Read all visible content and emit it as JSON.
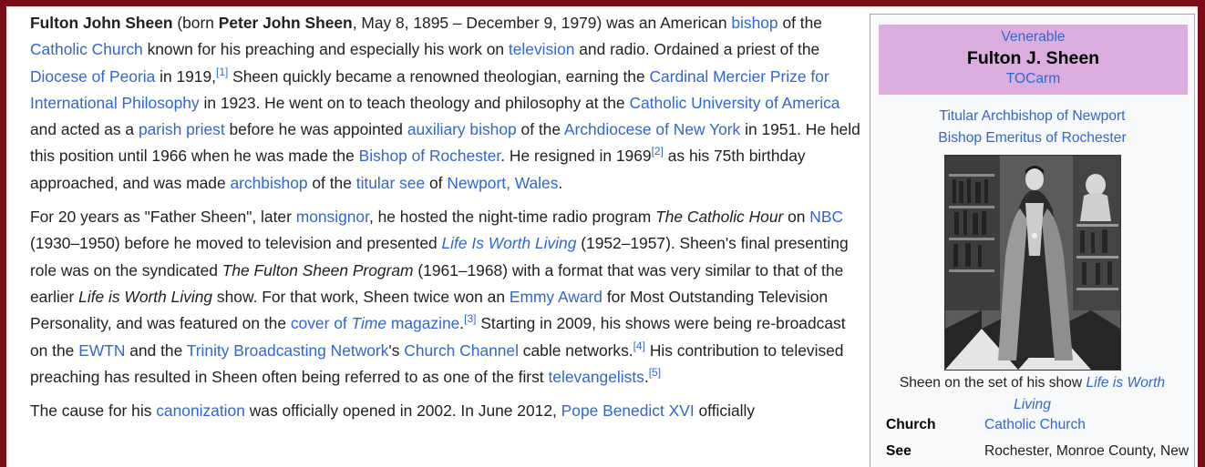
{
  "article": {
    "p1": {
      "t1": "Fulton John Sheen",
      "t2": " (born ",
      "t3": "Peter John Sheen",
      "t4": ", May 8, 1895 – December 9, 1979) was an American ",
      "l1": "bishop",
      "t5": " of the ",
      "l2": "Catholic Church",
      "t6": " known for his preaching and especially his work on ",
      "l3": "television",
      "t7": " and radio. Ordained a priest of the ",
      "l4": "Diocese of Peoria",
      "t8": " in 1919,",
      "r1": "[1]",
      "t9": " Sheen quickly became a renowned theologian, earning the ",
      "l5": "Cardinal Mercier Prize for International Philosophy",
      "t10": " in 1923. He went on to teach theology and philosophy at the ",
      "l6": "Catholic University of America",
      "t11": " and acted as a ",
      "l7": "parish priest",
      "t12": " before he was appointed ",
      "l8": "auxiliary bishop",
      "t13": " of the ",
      "l9": "Archdiocese of New York",
      "t14": " in 1951. He held this position until 1966 when he was made the ",
      "l10": "Bishop of Rochester",
      "t15": ". He resigned in 1969",
      "r2": "[2]",
      "t16": " as his 75th birthday approached, and was made ",
      "l11": "archbishop",
      "t17": " of the ",
      "l12": "titular see",
      "t18": " of ",
      "l13": "Newport, Wales",
      "t19": "."
    },
    "p2": {
      "t1": "For 20 years as \"Father Sheen\", later ",
      "l1": "monsignor",
      "t2": ", he hosted the night-time radio program ",
      "i1": "The Catholic Hour",
      "t3": " on ",
      "l2": "NBC",
      "t4": " (1930–1950) before he moved to television and presented ",
      "l3": "Life Is Worth Living",
      "t5": " (1952–1957). Sheen's final presenting role was on the syndicated ",
      "i2": "The Fulton Sheen Program",
      "t6": " (1961–1968) with a format that was very similar to that of the earlier ",
      "i3": "Life is Worth Living",
      "t7": " show. For that work, Sheen twice won an ",
      "l4": "Emmy Award",
      "t8": " for Most Outstanding Television Personality, and was featured on the ",
      "l5a": "cover of ",
      "l5b": "Time",
      "l5c": " magazine",
      "t9": ".",
      "r3": "[3]",
      "t10": " Starting in 2009, his shows were being re-broadcast on the ",
      "l6": "EWTN",
      "t11": " and the ",
      "l7": "Trinity Broadcasting Network",
      "t12": "'s ",
      "l8": "Church Channel",
      "t13": " cable networks.",
      "r4": "[4]",
      "t14": " His contribution to televised preaching has resulted in Sheen often being referred to as one of the first ",
      "l9": "televangelists",
      "t15": ".",
      "r5": "[5]"
    },
    "p3": {
      "t1": "The cause for his ",
      "l1": "canonization",
      "t2": " was officially opened in 2002. In June 2012, ",
      "l2": "Pope Benedict XVI",
      "t3": " officially"
    }
  },
  "infobox": {
    "honorific": "Venerable",
    "name": "Fulton J. Sheen",
    "postnominal": "TOCarm",
    "subtitle1": "Titular Archbishop of Newport",
    "subtitle2": "Bishop Emeritus of Rochester",
    "caption_text": "Sheen on the set of his show ",
    "caption_link": "Life is Worth Living",
    "rows": [
      {
        "label": "Church",
        "value": "Catholic Church"
      },
      {
        "label": "See",
        "value": "Rochester, Monroe County, New"
      }
    ]
  },
  "colors": {
    "link": "#3366cc",
    "frame": "#7a0c16",
    "infobox_header": "#dcaee0",
    "infobox_bg": "#f8f9fa"
  }
}
